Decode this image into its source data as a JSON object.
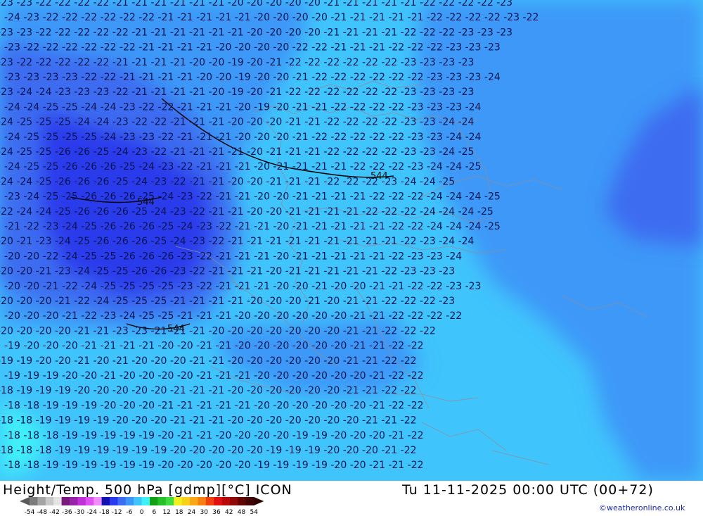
{
  "title_left": "Height/Temp. 500 hPa [gdmp][°C] ICON",
  "title_right": "Tu 11-11-2025 00:00 UTC (00+72)",
  "credit": "©weatheronline.co.uk",
  "height_labels": [
    "544",
    "544",
    "544"
  ],
  "colorbar": {
    "ticks": [
      "-54",
      "-48",
      "-42",
      "-36",
      "-30",
      "-24",
      "-18",
      "-12",
      "-6",
      "0",
      "6",
      "12",
      "18",
      "24",
      "30",
      "36",
      "42",
      "48",
      "54"
    ],
    "colors": [
      "#7c7c7c",
      "#a4a4a4",
      "#c8c8c8",
      "#e4e4e4",
      "#7a1a7a",
      "#9a22a8",
      "#c030d8",
      "#e050f0",
      "#f08cf8",
      "#1212b0",
      "#2a3aec",
      "#3c6cf0",
      "#3c98f8",
      "#40c4fc",
      "#40f0f8",
      "#14a014",
      "#28c028",
      "#40dc40",
      "#f0f020",
      "#f8d018",
      "#f8a818",
      "#f88010",
      "#f04010",
      "#e01010",
      "#b80808",
      "#900808",
      "#600404",
      "#400202"
    ]
  },
  "temperature_rows": [
    "-23 -23 -22 -22 -22 -22 -21 -21 -21 -21 -21 -21 -20 -20 -20 -20 -20 -21 -21 -21 -21 -21 -22 -22 -22 -22 -23",
    "-24 -23 -22 -22 -22 -22 -22 -22 -21 -21 -21 -21 -21 -20 -20 -20 -20 -21 -21 -21 -21 -21 -22 -22 -22 -22 -23 -22",
    "-23 -23 -22 -22 -22 -22 -22 -21 -21 -21 -21 -21 -21 -20 -20 -20 -20 -21 -21 -21 -21 -22 -22 -22 -23 -23 -23",
    "-23 -22 -22 -22 -22 -22 -22 -21 -21 -21 -21 -20 -20 -20 -20 -22 -22 -21 -21 -21 -22 -22 -22 -23 -23 -23",
    "-23 -22 -22 -22 -22 -22 -21 -21 -21 -21 -20 -20 -19 -20 -21 -22 -22 -22 -22 -22 -22 -23 -23 -23 -23",
    "-23 -23 -23 -23 -22 -22 -21 -21 -21 -21 -20 -20 -19 -20 -20 -21 -22 -22 -22 -22 -22 -22 -23 -23 -23 -24",
    "-23 -24 -24 -23 -23 -23 -22 -21 -21 -21 -21 -20 -19 -20 -21 -22 -22 -22 -22 -22 -22 -23 -23 -23 -23",
    "-24 -24 -25 -25 -24 -24 -23 -22 -22 -21 -21 -21 -20 -19 -20 -21 -21 -22 -22 -22 -22 -23 -23 -23 -24",
    "-24 -25 -25 -25 -24 -24 -23 -22 -22 -21 -21 -21 -20 -20 -20 -21 -21 -22 -22 -22 -22 -23 -23 -24 -24",
    "-24 -25 -25 -25 -25 -24 -23 -23 -22 -21 -21 -21 -20 -20 -20 -21 -22 -22 -22 -22 -22 -23 -23 -24 -24",
    "-24 -25 -25 -26 -26 -25 -24 -23 -22 -21 -21 -21 -21 -20 -21 -21 -21 -22 -22 -22 -22 -23 -23 -24 -25",
    "-24 -25 -25 -26 -26 -26 -25 -24 -23 -22 -21 -21 -21 -20 -21 -21 -21 -21 -22 -22 -22 -23 -24 -24 -25",
    "-24 -24 -25 -26 -26 -26 -25 -24 -23 -22 -21 -21 -20 -20 -21 -21 -21 -22 -22 -22 -23 -24 -24 -25",
    "-23 -24 -25 -25 -26 -26 -26 -25 -24 -23 -22 -21 -21 -20 -20 -21 -21 -21 -21 -22 -22 -22 -24 -24 -24 -25",
    "-22 -24 -24 -25 -26 -26 -26 -25 -24 -23 -22 -21 -21 -20 -20 -21 -21 -21 -21 -22 -22 -22 -24 -24 -24 -25",
    "-21 -22 -23 -24 -25 -26 -26 -26 -25 -24 -23 -22 -21 -21 -20 -21 -21 -21 -21 -21 -22 -22 -24 -24 -24 -25",
    "-20 -21 -23 -24 -25 -26 -26 -26 -25 -24 -23 -22 -21 -21 -21 -21 -21 -21 -21 -21 -21 -22 -23 -24 -24",
    "-20 -20 -22 -24 -25 -25 -26 -26 -26 -23 -22 -21 -21 -21 -20 -21 -21 -21 -21 -21 -22 -23 -23 -24",
    "-20 -20 -21 -23 -24 -25 -25 -26 -26 -23 -22 -21 -21 -21 -20 -21 -21 -21 -21 -21 -22 -23 -23 -23",
    "-20 -20 -21 -22 -24 -25 -25 -25 -25 -23 -22 -21 -21 -21 -20 -20 -21 -20 -20 -21 -21 -22 -22 -23 -23",
    "-20 -20 -20 -21 -22 -24 -25 -25 -25 -21 -21 -21 -21 -20 -20 -20 -21 -20 -21 -21 -22 -22 -22 -23",
    "-20 -20 -20 -21 -22 -23 -24 -25 -25 -21 -21 -21 -20 -20 -20 -20 -20 -20 -21 -21 -22 -22 -22 -22",
    "-20 -20 -20 -20 -21 -21 -23 -23 -21 -21 -21 -20 -20 -20 -20 -20 -20 -20 -21 -21 -22 -22 -22",
    "-19 -20 -20 -20 -21 -21 -21 -21 -20 -20 -21 -21 -20 -20 -20 -20 -20 -20 -21 -21 -22 -22",
    "-19 -19 -20 -20 -21 -20 -21 -20 -20 -20 -21 -21 -20 -20 -20 -20 -20 -20 -21 -21 -22 -22",
    "-19 -19 -19 -20 -20 -21 -20 -20 -20 -20 -21 -21 -21 -20 -20 -20 -20 -20 -20 -21 -22 -22",
    "-18 -19 -19 -19 -20 -20 -20 -20 -20 -21 -21 -21 -20 -20 -20 -20 -20 -20 -21 -21 -22 -22",
    "-18 -18 -19 -19 -19 -20 -20 -20 -21 -21 -21 -21 -21 -20 -20 -20 -20 -20 -20 -21 -22 -22",
    "-18 -18 -19 -19 -19 -19 -20 -20 -20 -21 -21 -21 -20 -20 -20 -20 -20 -20 -20 -21 -21 -22",
    "-18 -18 -18 -19 -19 -19 -19 -19 -20 -21 -21 -20 -20 -20 -20 -19 -19 -20 -20 -20 -21 -22",
    "-18 -18 -18 -19 -19 -19 -19 -19 -19 -20 -20 -20 -20 -20 -19 -19 -19 -20 -20 -20 -21 -22",
    "-18 -18 -19 -19 -19 -19 -19 -19 -20 -20 -20 -20 -20 -19 -19 -19 -19 -20 -20 -21 -21 -22"
  ]
}
